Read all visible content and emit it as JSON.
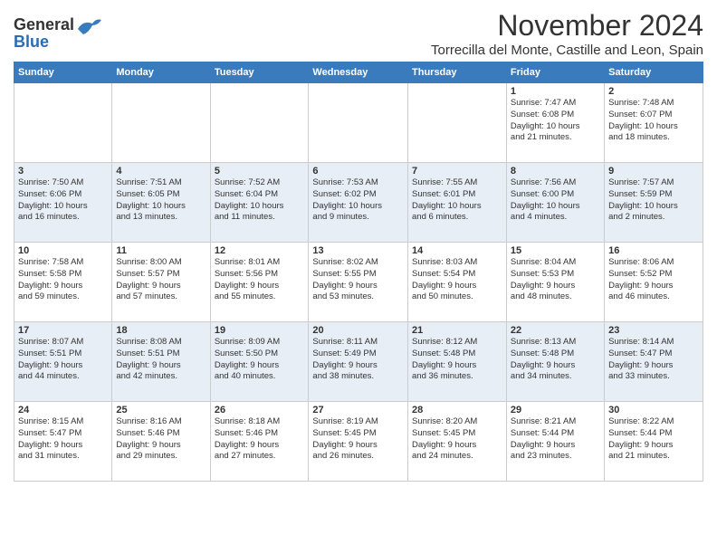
{
  "header": {
    "logo_general": "General",
    "logo_blue": "Blue",
    "month_title": "November 2024",
    "subtitle": "Torrecilla del Monte, Castille and Leon, Spain"
  },
  "weekdays": [
    "Sunday",
    "Monday",
    "Tuesday",
    "Wednesday",
    "Thursday",
    "Friday",
    "Saturday"
  ],
  "weeks": [
    [
      {
        "day": "",
        "info": ""
      },
      {
        "day": "",
        "info": ""
      },
      {
        "day": "",
        "info": ""
      },
      {
        "day": "",
        "info": ""
      },
      {
        "day": "",
        "info": ""
      },
      {
        "day": "1",
        "info": "Sunrise: 7:47 AM\nSunset: 6:08 PM\nDaylight: 10 hours\nand 21 minutes."
      },
      {
        "day": "2",
        "info": "Sunrise: 7:48 AM\nSunset: 6:07 PM\nDaylight: 10 hours\nand 18 minutes."
      }
    ],
    [
      {
        "day": "3",
        "info": "Sunrise: 7:50 AM\nSunset: 6:06 PM\nDaylight: 10 hours\nand 16 minutes."
      },
      {
        "day": "4",
        "info": "Sunrise: 7:51 AM\nSunset: 6:05 PM\nDaylight: 10 hours\nand 13 minutes."
      },
      {
        "day": "5",
        "info": "Sunrise: 7:52 AM\nSunset: 6:04 PM\nDaylight: 10 hours\nand 11 minutes."
      },
      {
        "day": "6",
        "info": "Sunrise: 7:53 AM\nSunset: 6:02 PM\nDaylight: 10 hours\nand 9 minutes."
      },
      {
        "day": "7",
        "info": "Sunrise: 7:55 AM\nSunset: 6:01 PM\nDaylight: 10 hours\nand 6 minutes."
      },
      {
        "day": "8",
        "info": "Sunrise: 7:56 AM\nSunset: 6:00 PM\nDaylight: 10 hours\nand 4 minutes."
      },
      {
        "day": "9",
        "info": "Sunrise: 7:57 AM\nSunset: 5:59 PM\nDaylight: 10 hours\nand 2 minutes."
      }
    ],
    [
      {
        "day": "10",
        "info": "Sunrise: 7:58 AM\nSunset: 5:58 PM\nDaylight: 9 hours\nand 59 minutes."
      },
      {
        "day": "11",
        "info": "Sunrise: 8:00 AM\nSunset: 5:57 PM\nDaylight: 9 hours\nand 57 minutes."
      },
      {
        "day": "12",
        "info": "Sunrise: 8:01 AM\nSunset: 5:56 PM\nDaylight: 9 hours\nand 55 minutes."
      },
      {
        "day": "13",
        "info": "Sunrise: 8:02 AM\nSunset: 5:55 PM\nDaylight: 9 hours\nand 53 minutes."
      },
      {
        "day": "14",
        "info": "Sunrise: 8:03 AM\nSunset: 5:54 PM\nDaylight: 9 hours\nand 50 minutes."
      },
      {
        "day": "15",
        "info": "Sunrise: 8:04 AM\nSunset: 5:53 PM\nDaylight: 9 hours\nand 48 minutes."
      },
      {
        "day": "16",
        "info": "Sunrise: 8:06 AM\nSunset: 5:52 PM\nDaylight: 9 hours\nand 46 minutes."
      }
    ],
    [
      {
        "day": "17",
        "info": "Sunrise: 8:07 AM\nSunset: 5:51 PM\nDaylight: 9 hours\nand 44 minutes."
      },
      {
        "day": "18",
        "info": "Sunrise: 8:08 AM\nSunset: 5:51 PM\nDaylight: 9 hours\nand 42 minutes."
      },
      {
        "day": "19",
        "info": "Sunrise: 8:09 AM\nSunset: 5:50 PM\nDaylight: 9 hours\nand 40 minutes."
      },
      {
        "day": "20",
        "info": "Sunrise: 8:11 AM\nSunset: 5:49 PM\nDaylight: 9 hours\nand 38 minutes."
      },
      {
        "day": "21",
        "info": "Sunrise: 8:12 AM\nSunset: 5:48 PM\nDaylight: 9 hours\nand 36 minutes."
      },
      {
        "day": "22",
        "info": "Sunrise: 8:13 AM\nSunset: 5:48 PM\nDaylight: 9 hours\nand 34 minutes."
      },
      {
        "day": "23",
        "info": "Sunrise: 8:14 AM\nSunset: 5:47 PM\nDaylight: 9 hours\nand 33 minutes."
      }
    ],
    [
      {
        "day": "24",
        "info": "Sunrise: 8:15 AM\nSunset: 5:47 PM\nDaylight: 9 hours\nand 31 minutes."
      },
      {
        "day": "25",
        "info": "Sunrise: 8:16 AM\nSunset: 5:46 PM\nDaylight: 9 hours\nand 29 minutes."
      },
      {
        "day": "26",
        "info": "Sunrise: 8:18 AM\nSunset: 5:46 PM\nDaylight: 9 hours\nand 27 minutes."
      },
      {
        "day": "27",
        "info": "Sunrise: 8:19 AM\nSunset: 5:45 PM\nDaylight: 9 hours\nand 26 minutes."
      },
      {
        "day": "28",
        "info": "Sunrise: 8:20 AM\nSunset: 5:45 PM\nDaylight: 9 hours\nand 24 minutes."
      },
      {
        "day": "29",
        "info": "Sunrise: 8:21 AM\nSunset: 5:44 PM\nDaylight: 9 hours\nand 23 minutes."
      },
      {
        "day": "30",
        "info": "Sunrise: 8:22 AM\nSunset: 5:44 PM\nDaylight: 9 hours\nand 21 minutes."
      }
    ]
  ]
}
